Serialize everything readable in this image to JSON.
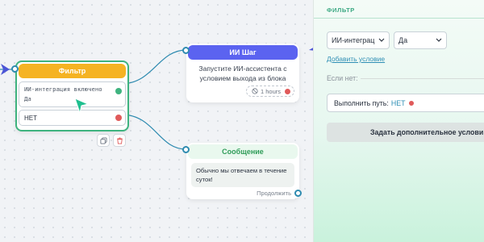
{
  "canvas": {
    "filter_node": {
      "title": "Фильтр",
      "condition_lines": [
        "ИИ-интеграция включено",
        "Да"
      ],
      "else_label": "НЕТ",
      "copy_icon": "copy-icon",
      "delete_icon": "trash-icon"
    },
    "ai_node": {
      "title": "ИИ Шаг",
      "text": "Запустите ИИ-ассистента с условием выхода из блока",
      "timer": "1 hours",
      "timer_icon": "no-entry-icon"
    },
    "message_node": {
      "title": "Сообщение",
      "text": "Обычно мы отвечаем в течение суток!",
      "continue_label": "Продолжить"
    }
  },
  "panel": {
    "header": "ФИЛЬТР",
    "field_select": "ИИ-интеграц",
    "value_select": "Да",
    "add_condition": "Добавить условие",
    "else_label": "Если нет:",
    "path_prefix": "Выполнить путь:",
    "path_value": "НЕТ",
    "extra_condition_button": "Задать дополнительное услови"
  },
  "colors": {
    "accent_green": "#3fb37f",
    "filter_yellow": "#f5b323",
    "ai_purple": "#5b63f0",
    "cursor_teal": "#1fbf8f",
    "cursor_blue": "#4b55d6",
    "red_dot": "#e05a5a"
  }
}
